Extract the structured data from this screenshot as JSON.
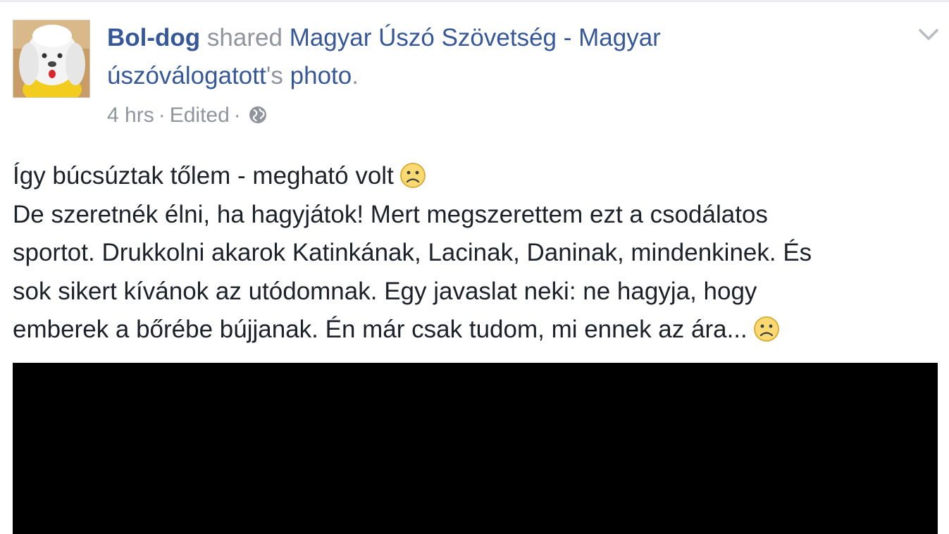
{
  "post": {
    "author": "Bol-dog",
    "action": "shared",
    "source_line1": "Magyar Úszó Szövetség - Magyar",
    "source_line2": "úszóválogatott",
    "possessive": "'s",
    "object": "photo",
    "period": ".",
    "time": "4 hrs",
    "separator": "·",
    "edited": "Edited",
    "privacy_icon": "globe-icon",
    "menu_icon": "chevron-down-icon",
    "text_lines": [
      "Így búcsúztak tőlem - megható volt",
      "De szeretnék élni, ha hagyjátok! Mert megszerettem ezt a csodálatos",
      "sportot. Drukkolni akarok Katinkának, Lacinak, Daninak, mindenkinek. És",
      "sok sikert kívánok az utódomnak. Egy javaslat neki: ne hagyja, hogy",
      "emberek a bőrébe bújjanak. Én már csak tudom, mi ennek az ára..."
    ],
    "emoji": "sad-face-emoji"
  },
  "colors": {
    "link": "#365899",
    "muted": "#90949c",
    "text": "#1d2129",
    "photo_background": "#000000"
  }
}
